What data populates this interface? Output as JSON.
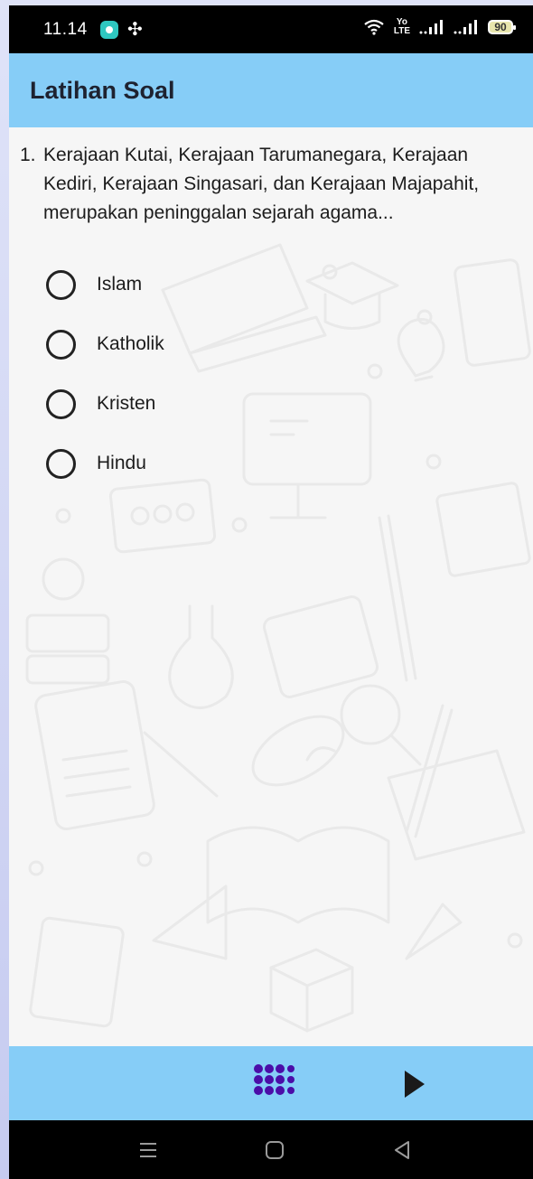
{
  "status_bar": {
    "time": "11.14",
    "volte_top": "Yo",
    "volte_bottom": "LTE",
    "battery": "90"
  },
  "app_bar": {
    "title": "Latihan Soal"
  },
  "question": {
    "number": "1.",
    "text": "Kerajaan Kutai, Kerajaan Tarumanegara, Kerajaan Kediri, Kerajaan Singasari, dan Kerajaan Majapahit, merupakan peninggalan sejarah agama...",
    "options": [
      "Islam",
      "Katholik",
      "Kristen",
      "Hindu"
    ]
  },
  "icons": {
    "grid_color": "#4b0da8",
    "next_color": "#1a1a1a"
  },
  "colors": {
    "app_bar": "#86cdf7",
    "background": "#f6f6f6"
  }
}
